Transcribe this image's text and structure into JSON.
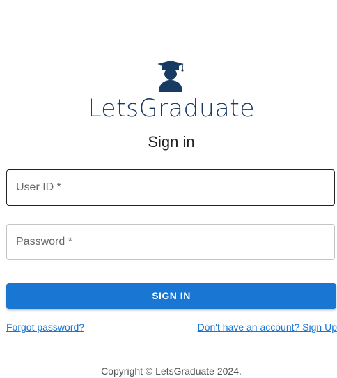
{
  "brand": {
    "name": "LetsGraduate",
    "logo_icon": "graduate-cap-icon",
    "color": "#183b63"
  },
  "page_title": "Sign in",
  "form": {
    "user_id_placeholder": "User ID *",
    "password_placeholder": "Password *",
    "submit_label": "SIGN IN"
  },
  "links": {
    "forgot_password": "Forgot password?",
    "sign_up": "Don't have an account? Sign Up"
  },
  "footer": {
    "copyright": "Copyright © LetsGraduate 2024."
  },
  "colors": {
    "accent": "#1976d2"
  }
}
